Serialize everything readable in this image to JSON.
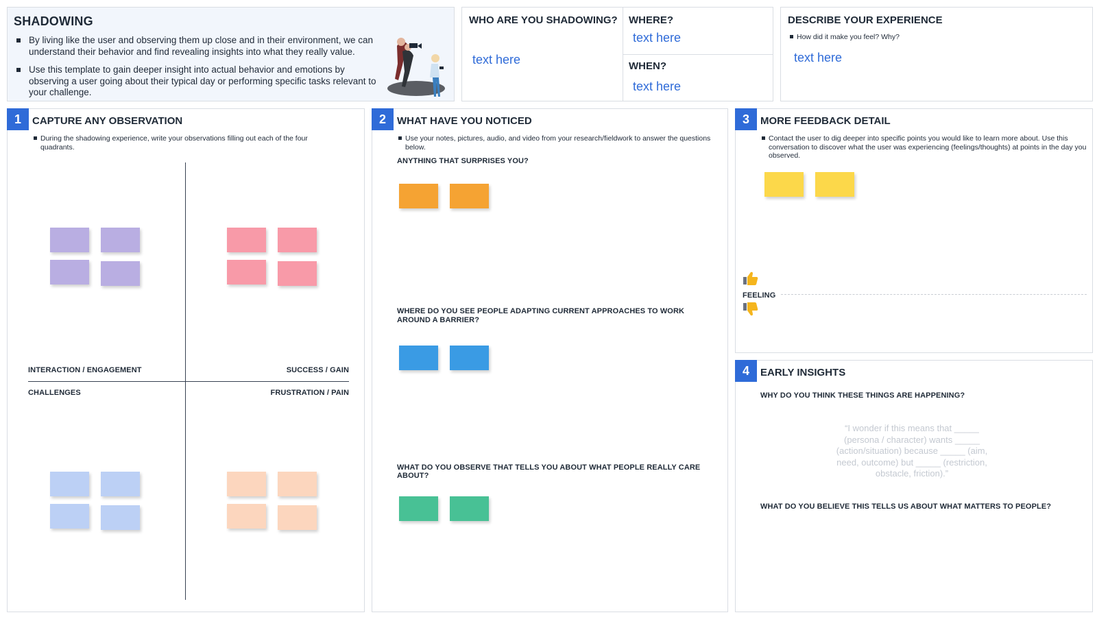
{
  "intro": {
    "title": "SHADOWING",
    "bullets": [
      "By living like the user and observing them up close and in their environment, we can understand their behavior and find revealing insights into what they really value.",
      "Use this template to gain deeper insight into actual behavior and emotions by observing a user going about their typical day or performing specific tasks relevant to your challenge."
    ]
  },
  "who": {
    "label": "WHO ARE YOU SHADOWING?",
    "value": "text here"
  },
  "where": {
    "label": "WHERE?",
    "value": "text here"
  },
  "when": {
    "label": "WHEN?",
    "value": "text here"
  },
  "experience": {
    "label": "DESCRIBE YOUR EXPERIENCE",
    "hint": "How did it make you feel? Why?",
    "value": "text here"
  },
  "section1": {
    "number": "1",
    "title": "CAPTURE ANY OBSERVATION",
    "hint": "During the shadowing experience, write your observations filling out each of the four quadrants.",
    "quadrants": {
      "top_left": "INTERACTION / ENGAGEMENT",
      "top_right": "SUCCESS / GAIN",
      "bottom_left": "CHALLENGES",
      "bottom_right": "FRUSTRATION / PAIN"
    },
    "note_colors": {
      "interaction": "#b9aee2",
      "success": "#f89aa8",
      "challenges": "#bcd0f5",
      "frustration": "#fcd6be"
    }
  },
  "section2": {
    "number": "2",
    "title": "WHAT HAVE YOU NOTICED",
    "hint": "Use your notes, pictures, audio, and video from your research/fieldwork to answer the questions below.",
    "questions": [
      "ANYTHING THAT SURPRISES YOU?",
      "WHERE DO YOU SEE PEOPLE ADAPTING CURRENT APPROACHES TO WORK AROUND A BARRIER?",
      "WHAT DO YOU OBSERVE THAT TELLS YOU ABOUT WHAT PEOPLE REALLY CARE ABOUT?"
    ],
    "note_colors": [
      "#f5a333",
      "#3a9be4",
      "#48c195"
    ]
  },
  "section3": {
    "number": "3",
    "title": "MORE FEEDBACK DETAIL",
    "hint": "Contact the user to dig deeper into specific points you would like to learn more about. Use this conversation to discover what the user was experiencing (feelings/thoughts) at points in the day you observed.",
    "feeling_label": "FEELING",
    "note_color": "#fcd84a"
  },
  "section4": {
    "number": "4",
    "title": "EARLY INSIGHTS",
    "questions": [
      "WHY DO YOU THINK THESE THINGS ARE HAPPENING?",
      "WHAT DO YOU BELIEVE THIS TELLS US ABOUT WHAT MATTERS TO PEOPLE?"
    ],
    "quote": "“I wonder if this means that _____ (persona / character) wants _____ (action/situation) because _____ (aim, need, outcome) but _____ (restriction, obstacle, friction).”"
  },
  "icons": [
    "thumbs-up-icon",
    "thumbs-down-icon",
    "people-illustration"
  ]
}
